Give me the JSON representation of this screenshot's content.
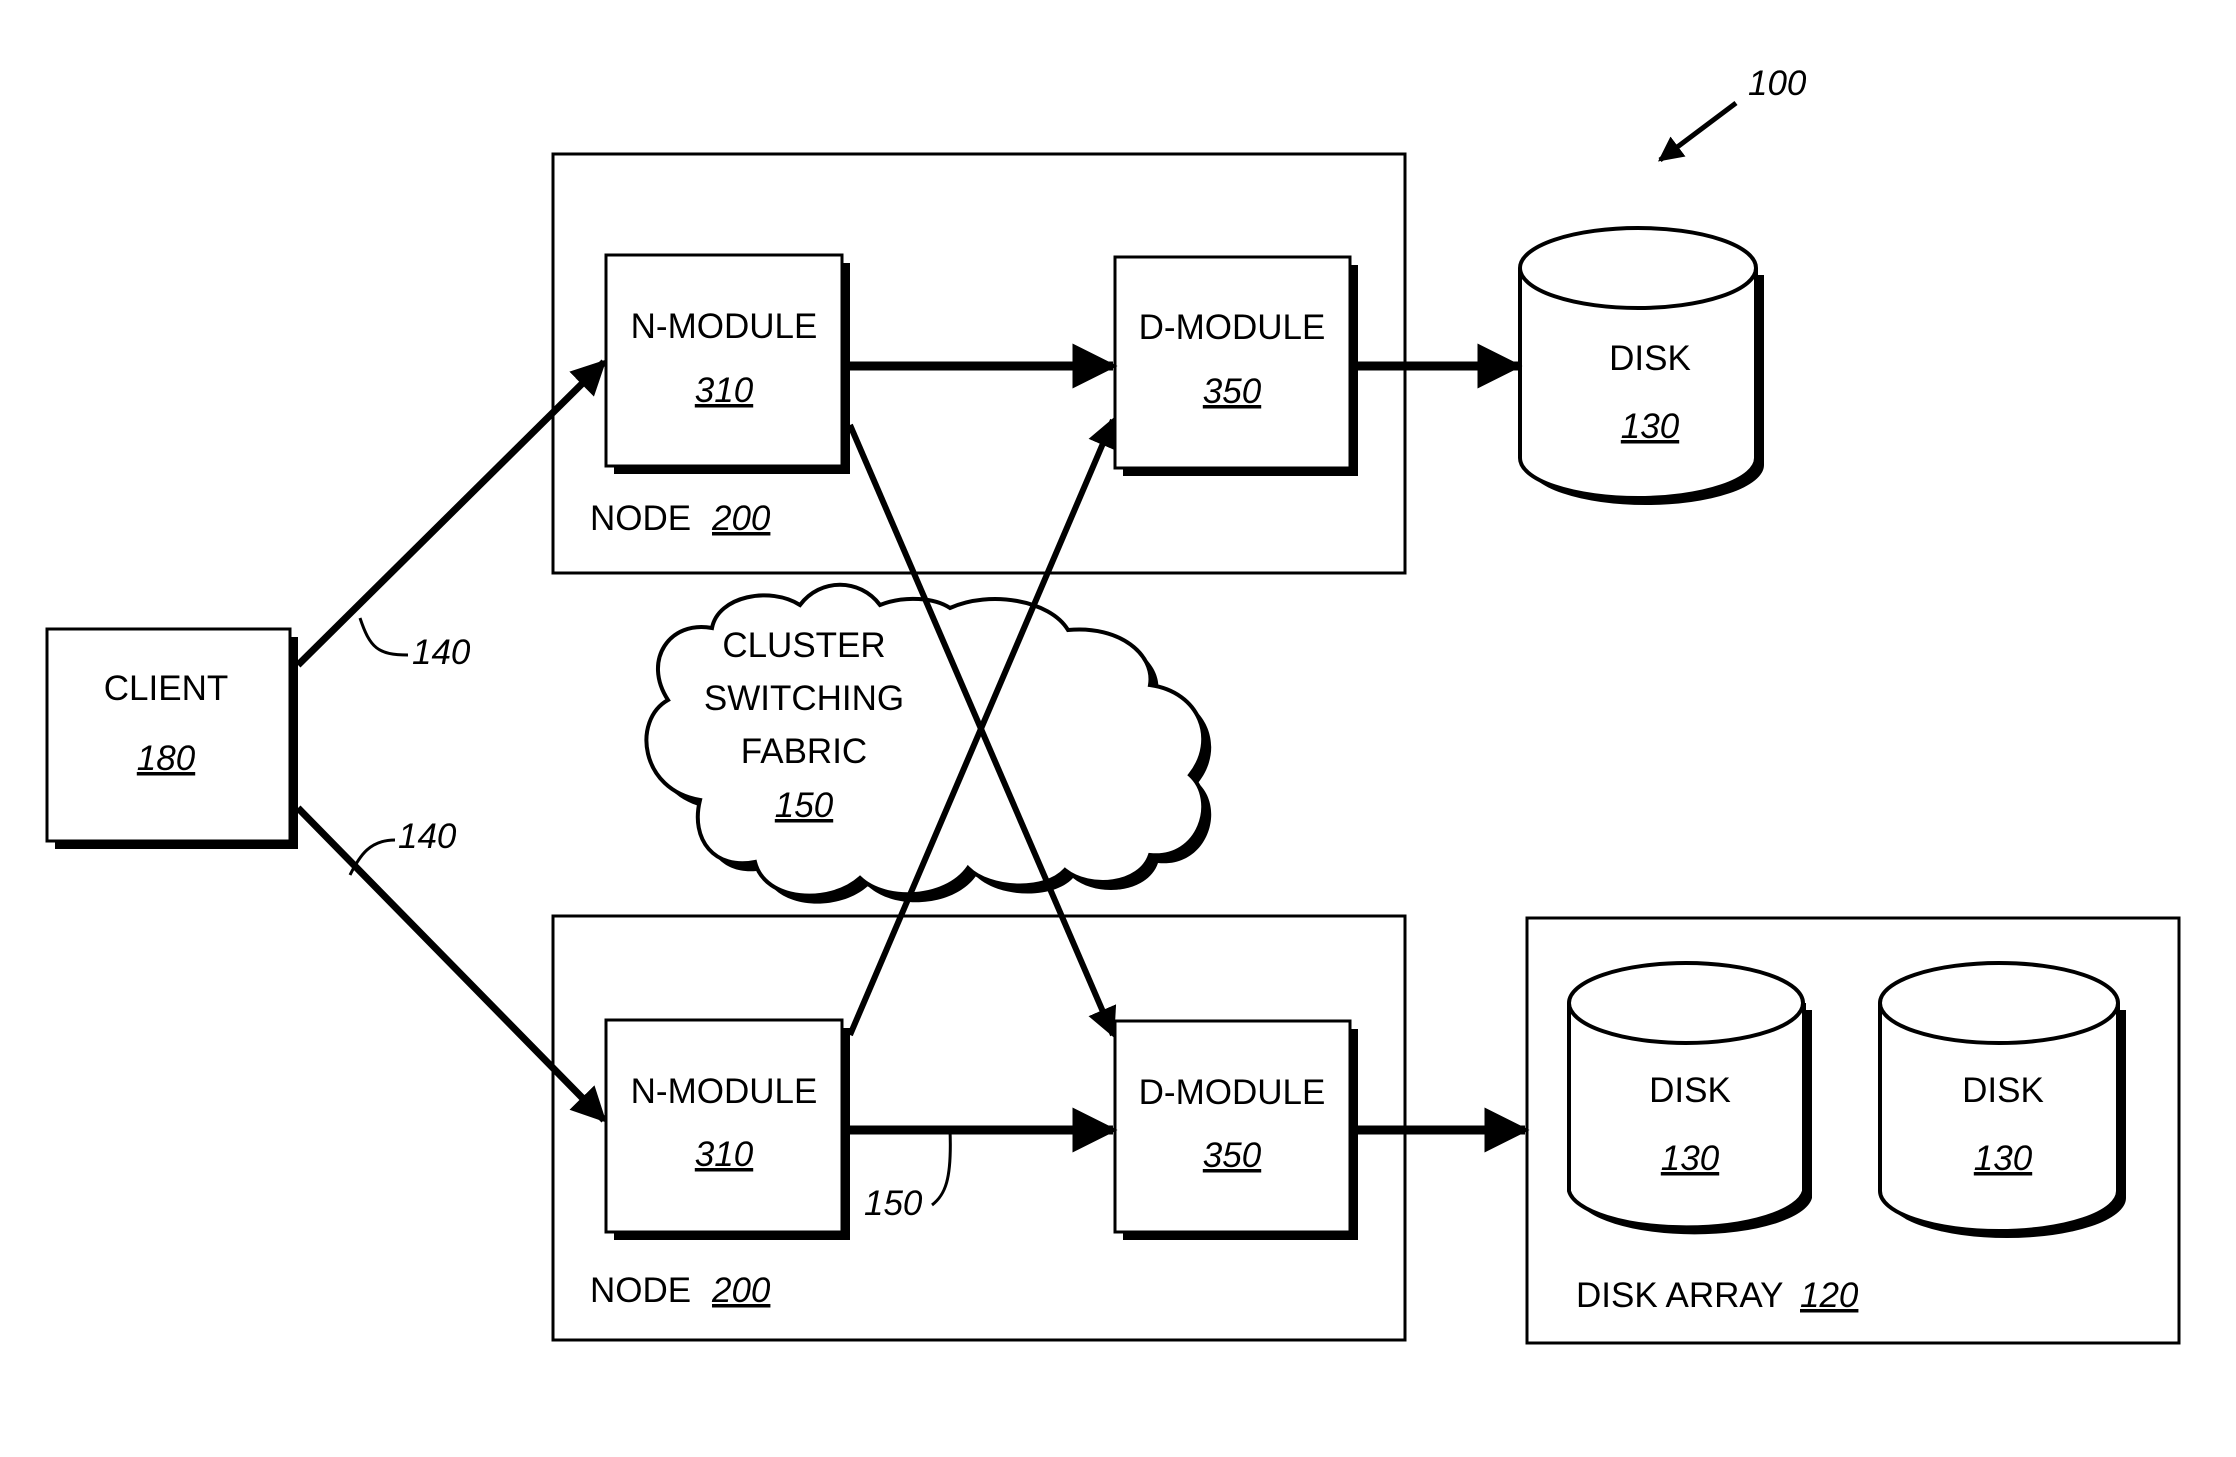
{
  "figure": {
    "reference": "100",
    "colors": {
      "stroke": "#000000",
      "background": "#ffffff"
    }
  },
  "client": {
    "label": "CLIENT",
    "ref": "180"
  },
  "links": {
    "client_to_node_ref": "140",
    "cluster_link_ref": "150"
  },
  "fabric": {
    "line1": "CLUSTER",
    "line2": "SWITCHING",
    "line3": "FABRIC",
    "ref": "150"
  },
  "nodes": [
    {
      "label": "NODE",
      "ref": "200",
      "n_module": {
        "label": "N-MODULE",
        "ref": "310"
      },
      "d_module": {
        "label": "D-MODULE",
        "ref": "350"
      }
    },
    {
      "label": "NODE",
      "ref": "200",
      "n_module": {
        "label": "N-MODULE",
        "ref": "310"
      },
      "d_module": {
        "label": "D-MODULE",
        "ref": "350"
      }
    }
  ],
  "disk_single": {
    "label": "DISK",
    "ref": "130"
  },
  "disk_array": {
    "label": "DISK ARRAY",
    "ref": "120",
    "disks": [
      {
        "label": "DISK",
        "ref": "130"
      },
      {
        "label": "DISK",
        "ref": "130"
      }
    ]
  }
}
